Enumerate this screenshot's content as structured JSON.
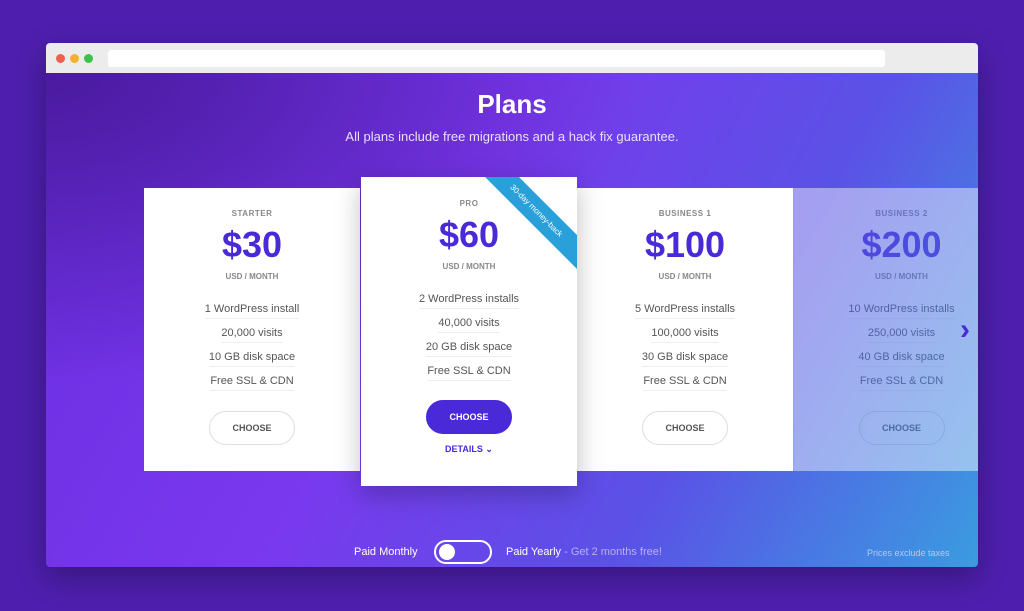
{
  "header": {
    "title": "Plans",
    "subtitle": "All plans include free migrations and a hack fix guarantee."
  },
  "plans": [
    {
      "name": "STARTER",
      "price": "$30",
      "unit": "USD / MONTH",
      "features": [
        "1 WordPress install",
        "20,000 visits",
        "10 GB disk space",
        "Free SSL & CDN"
      ],
      "button": "CHOOSE"
    },
    {
      "name": "PRO",
      "price": "$60",
      "unit": "USD / MONTH",
      "features": [
        "2 WordPress installs",
        "40,000 visits",
        "20 GB disk space",
        "Free SSL & CDN"
      ],
      "button": "CHOOSE",
      "details": "DETAILS",
      "ribbon": "30-day money-back"
    },
    {
      "name": "BUSINESS 1",
      "price": "$100",
      "unit": "USD / MONTH",
      "features": [
        "5 WordPress installs",
        "100,000 visits",
        "30 GB disk space",
        "Free SSL & CDN"
      ],
      "button": "CHOOSE"
    },
    {
      "name": "BUSINESS 2",
      "price": "$200",
      "unit": "USD / MONTH",
      "features": [
        "10 WordPress installs",
        "250,000 visits",
        "40 GB disk space",
        "Free SSL & CDN"
      ],
      "button": "CHOOSE"
    }
  ],
  "billing": {
    "monthly": "Paid Monthly",
    "yearly": "Paid Yearly",
    "yearly_note": " - Get 2 months free!",
    "yearly_selected": false,
    "taxes": "Prices exclude taxes"
  },
  "colors": {
    "accent": "#4a2ad8",
    "ribbon": "#2aa0da"
  }
}
